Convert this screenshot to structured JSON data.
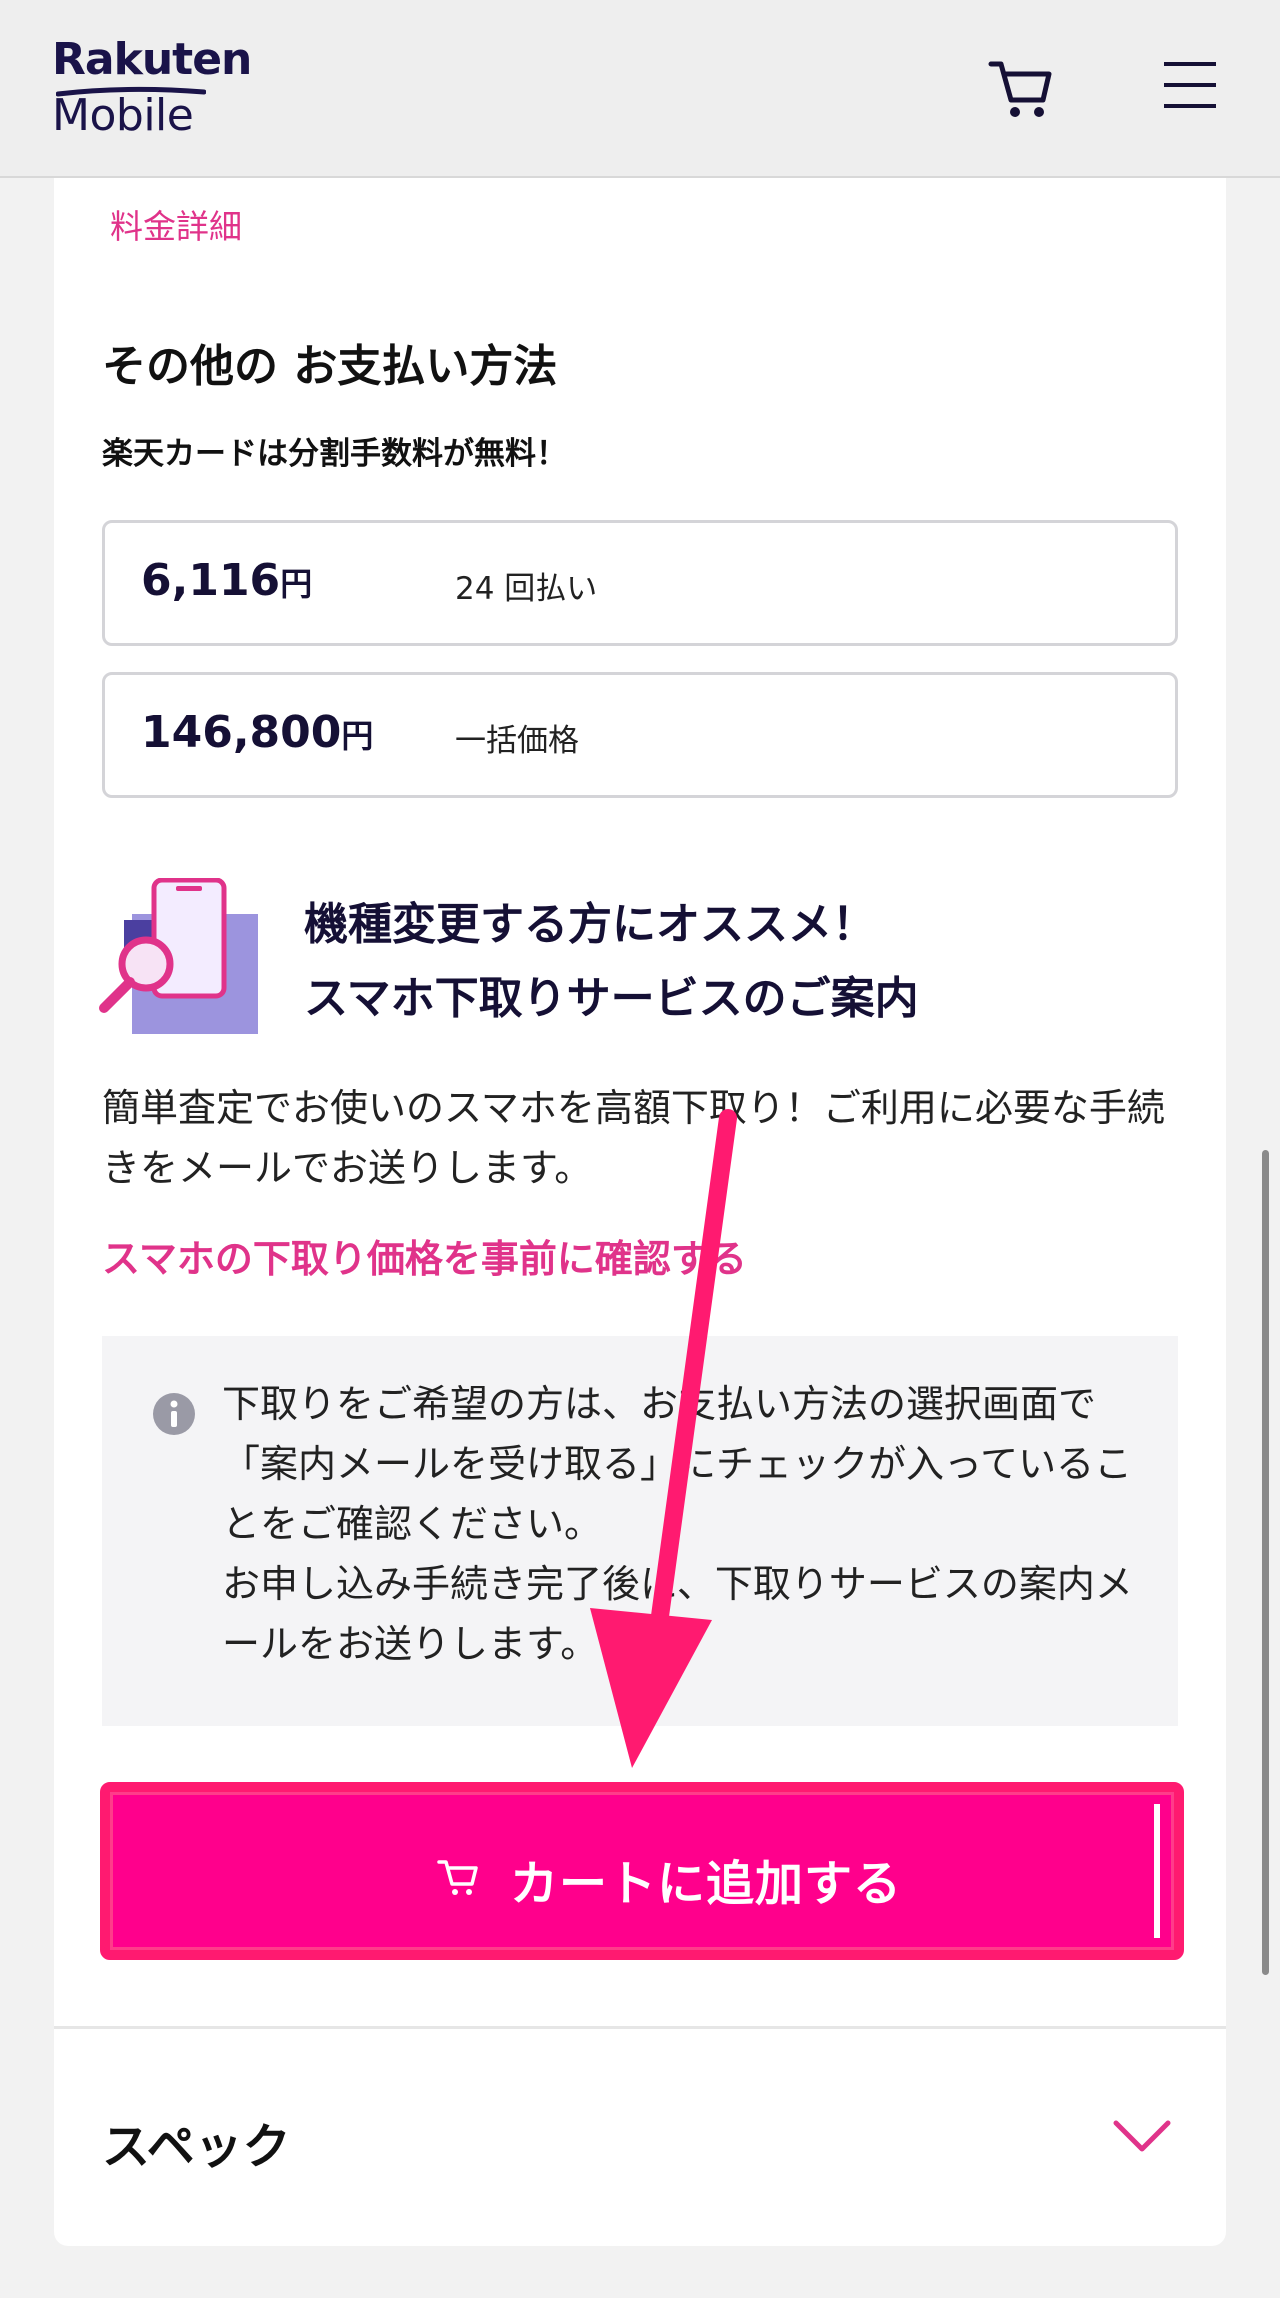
{
  "header": {
    "logo_brand": "Rakuten",
    "logo_product": "Mobile"
  },
  "card": {
    "price_detail_link": "料金詳細",
    "section_title": "その他の お支払い方法",
    "sub_note": "楽天カードは分割手数料が無料！",
    "prices": [
      {
        "amount": "6,116",
        "unit": "円",
        "label": "24 回払い"
      },
      {
        "amount": "146,800",
        "unit": "円",
        "label": "一括価格"
      }
    ],
    "tradein": {
      "title_line1": "機種変更する方にオススメ！",
      "title_line2": "スマホ下取りサービスのご案内",
      "description": "簡単査定でお使いのスマホを高額下取り！ご利用に必要な手続きをメールでお送りします。",
      "link": "スマホの下取り価格を事前に確認する"
    },
    "notice": {
      "line1": "下取りをご希望の方は、お支払い方法の選択画面で「案内メールを受け取る」にチェックが入っていることをご確認ください。",
      "line2": "お申し込み手続き完了後に、下取りサービスの案内メールをお送りします。"
    },
    "cta": {
      "label": "カートに追加する"
    },
    "spec": {
      "title": "スペック"
    }
  },
  "colors": {
    "accent": "#ff008c",
    "link": "#e0338a",
    "brand_navy": "#1a1349"
  },
  "icons": [
    "cart-icon",
    "menu-icon",
    "info-icon",
    "chevron-down-icon",
    "arrow-annotation"
  ]
}
